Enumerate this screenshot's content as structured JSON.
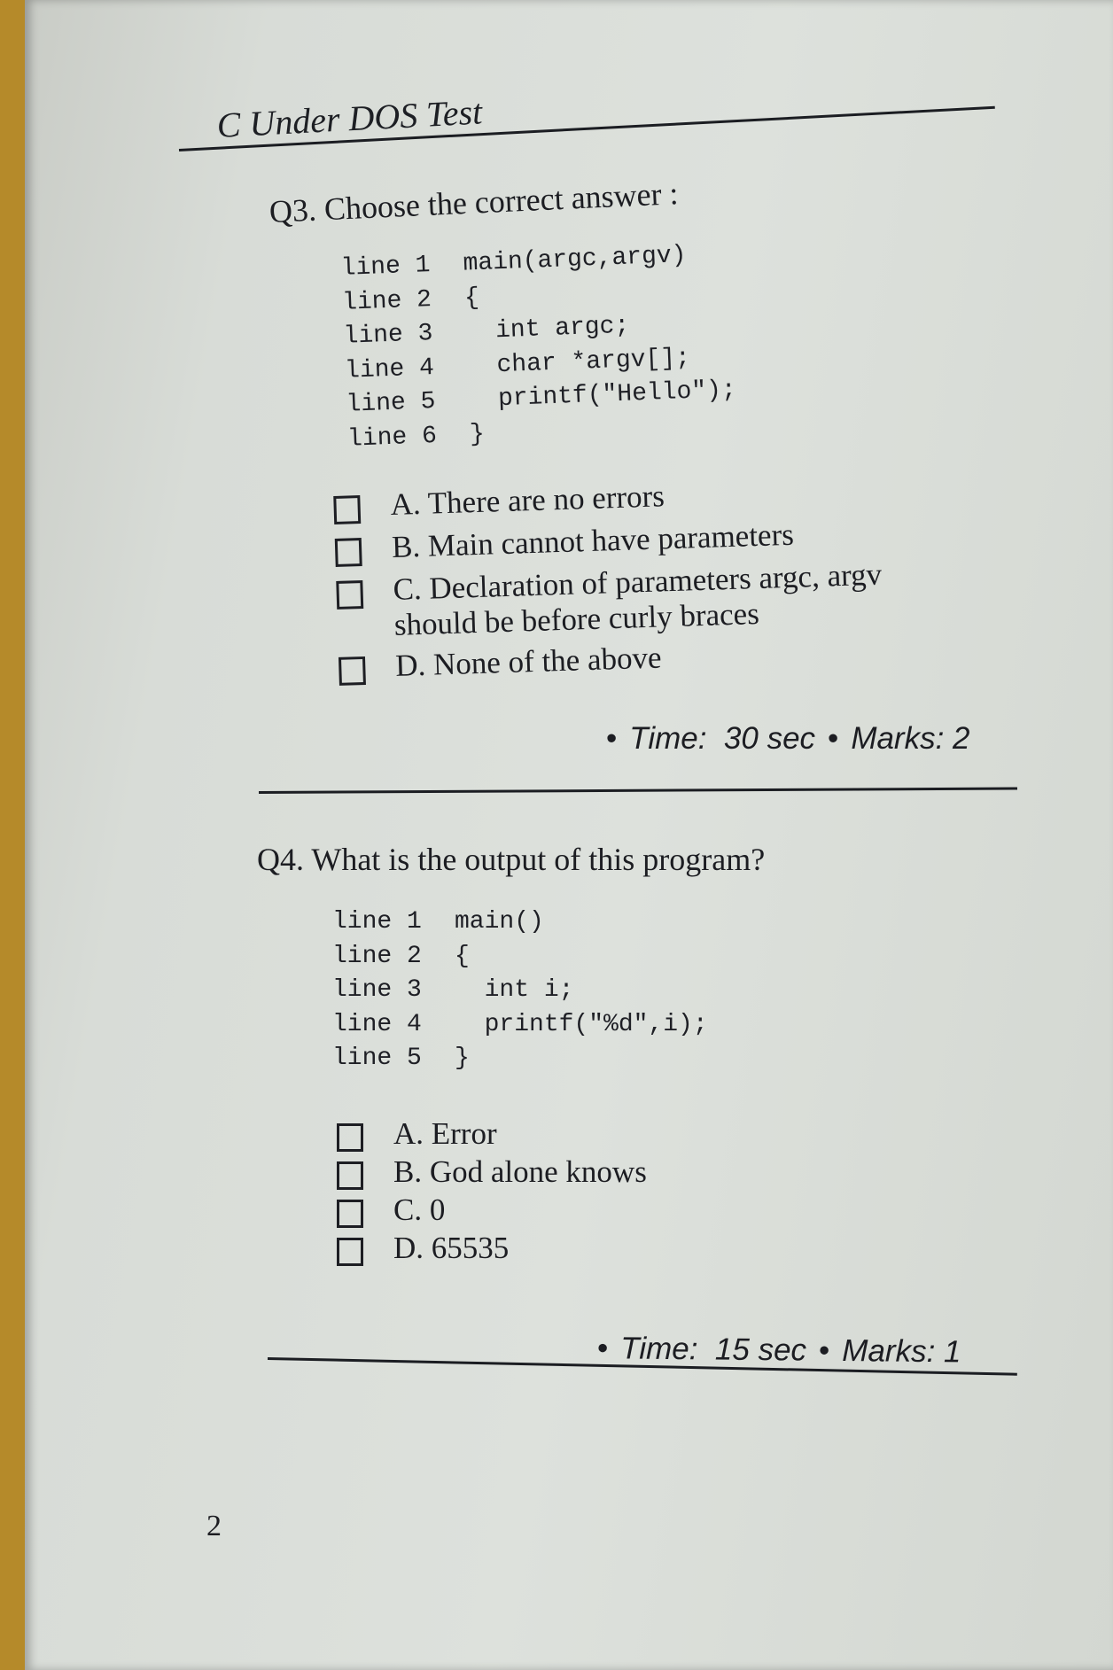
{
  "header": {
    "title": "C Under DOS Test"
  },
  "q3": {
    "question": "Q3. Choose the correct answer :",
    "code": [
      {
        "ln": "line 1",
        "src": "main(argc,argv)"
      },
      {
        "ln": "line 2",
        "src": "{"
      },
      {
        "ln": "line 3",
        "src": "  int argc;"
      },
      {
        "ln": "line 4",
        "src": "  char *argv[];"
      },
      {
        "ln": "line 5",
        "src": "  printf(\"Hello\");"
      },
      {
        "ln": "line 6",
        "src": "}"
      }
    ],
    "options": {
      "a": "A. There are no errors",
      "b": "B. Main cannot have parameters",
      "c_line1": "C. Declaration of parameters argc, argv",
      "c_line2": "should be before curly braces",
      "d": "D. None of the above"
    },
    "time_label": "Time:",
    "time_value": "30 sec",
    "marks_label": "Marks:",
    "marks_value": "2",
    "bullet": "•"
  },
  "q4": {
    "question": "Q4. What is the output of this program?",
    "code": [
      {
        "ln": "line 1",
        "src": "main()"
      },
      {
        "ln": "line 2",
        "src": "{"
      },
      {
        "ln": "line 3",
        "src": "  int i;"
      },
      {
        "ln": "line 4",
        "src": "  printf(\"%d\",i);"
      },
      {
        "ln": "line 5",
        "src": "}"
      }
    ],
    "options": {
      "a": "A. Error",
      "b": "B. God alone knows",
      "c": "C. 0",
      "d": "D. 65535"
    },
    "time_label": "Time:",
    "time_value": "15 sec",
    "marks_label": "Marks:",
    "marks_value": "1",
    "bullet": "•"
  },
  "footer": {
    "page_number": "2"
  }
}
